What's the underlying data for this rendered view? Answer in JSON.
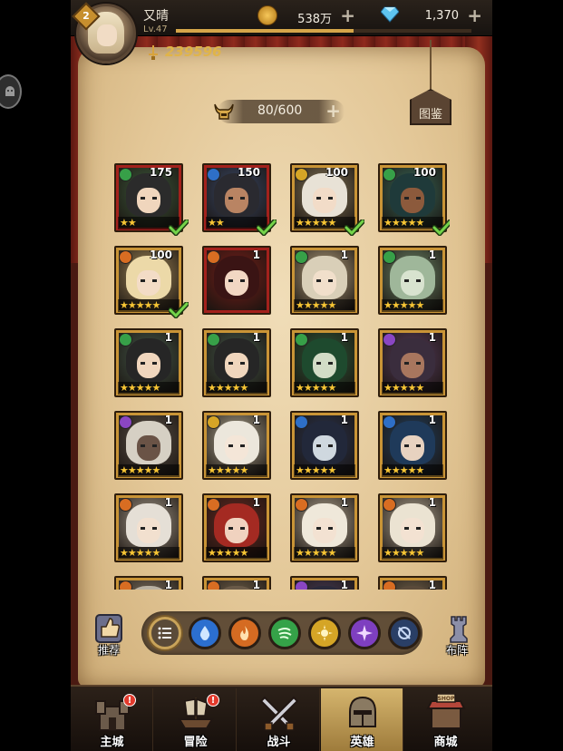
{
  "player": {
    "name": "又晴",
    "level_label": "Lv.47",
    "badge_level": "2",
    "power": "239596",
    "xp_fraction": 0.6
  },
  "resources": {
    "gold": "538万",
    "gems": "1,370"
  },
  "hero_count": "80/600",
  "collection_label": "图鉴",
  "heroes": [
    {
      "level": "175",
      "element": "wind",
      "stars": 2,
      "frame": "red",
      "check": true,
      "hair": "#2b2b2b",
      "skin": "#f0d6bd",
      "bg": "#3d5a3d"
    },
    {
      "level": "150",
      "element": "water",
      "stars": 2,
      "frame": "red",
      "check": true,
      "hair": "#2a2a30",
      "skin": "#b98463",
      "bg": "#3a4a6a"
    },
    {
      "level": "100",
      "element": "light",
      "stars": 5,
      "frame": "gold",
      "check": true,
      "hair": "#e8e2d6",
      "skin": "#f2dcc8",
      "bg": "#8a7a5a"
    },
    {
      "level": "100",
      "element": "wind",
      "stars": 5,
      "frame": "gold",
      "check": true,
      "hair": "#1f3a3a",
      "skin": "#8c5a3c",
      "bg": "#3a6a5a"
    },
    {
      "level": "100",
      "element": "fire",
      "stars": 5,
      "frame": "gold",
      "check": true,
      "hair": "#ecd9a8",
      "skin": "#f3dcc6",
      "bg": "#a48a5a"
    },
    {
      "level": "1",
      "element": "fire",
      "stars": 0,
      "frame": "red",
      "check": false,
      "hair": "#3a1414",
      "skin": "#f2d7c3",
      "bg": "#7a1f1a"
    },
    {
      "level": "1",
      "element": "wind",
      "stars": 5,
      "frame": "gold",
      "check": false,
      "hair": "#d9cfb8",
      "skin": "#f1dfcb",
      "bg": "#b8a480"
    },
    {
      "level": "1",
      "element": "wind",
      "stars": 5,
      "frame": "gold",
      "check": false,
      "hair": "#9fb79a",
      "skin": "#d8e3cf",
      "bg": "#6f8a6a"
    },
    {
      "level": "1",
      "element": "wind",
      "stars": 5,
      "frame": "gold",
      "check": false,
      "hair": "#262626",
      "skin": "#f0d6bd",
      "bg": "#44584a"
    },
    {
      "level": "1",
      "element": "wind",
      "stars": 5,
      "frame": "gold",
      "check": false,
      "hair": "#262626",
      "skin": "#f0d6bd",
      "bg": "#44584a"
    },
    {
      "level": "1",
      "element": "wind",
      "stars": 5,
      "frame": "gold",
      "check": false,
      "hair": "#1e4a2e",
      "skin": "#d2dcc6",
      "bg": "#2f5a3a"
    },
    {
      "level": "1",
      "element": "dark",
      "stars": 5,
      "frame": "gold",
      "check": false,
      "hair": "#3a2d3d",
      "skin": "#a8765e",
      "bg": "#5a3e5e"
    },
    {
      "level": "1",
      "element": "dark",
      "stars": 5,
      "frame": "gold",
      "check": false,
      "hair": "#d6d0c4",
      "skin": "#6a5346",
      "bg": "#5c5248"
    },
    {
      "level": "1",
      "element": "light",
      "stars": 5,
      "frame": "gold",
      "check": false,
      "hair": "#ece7dc",
      "skin": "#f4e6d8",
      "bg": "#b4ab94"
    },
    {
      "level": "1",
      "element": "water",
      "stars": 5,
      "frame": "gold",
      "check": false,
      "hair": "#22283a",
      "skin": "#cfd8df",
      "bg": "#2a3550"
    },
    {
      "level": "1",
      "element": "water",
      "stars": 5,
      "frame": "gold",
      "check": false,
      "hair": "#1f3a5a",
      "skin": "#e7d2c0",
      "bg": "#23405e"
    },
    {
      "level": "1",
      "element": "fire",
      "stars": 5,
      "frame": "gold",
      "check": false,
      "hair": "#e5dfd6",
      "skin": "#f2e0cf",
      "bg": "#a89c8c"
    },
    {
      "level": "1",
      "element": "fire",
      "stars": 5,
      "frame": "gold",
      "check": false,
      "hair": "#a42a22",
      "skin": "#f0d2bf",
      "bg": "#6a2a22"
    },
    {
      "level": "1",
      "element": "fire",
      "stars": 5,
      "frame": "gold",
      "check": false,
      "hair": "#efe8da",
      "skin": "#f3e2d2",
      "bg": "#b8ab96"
    },
    {
      "level": "1",
      "element": "fire",
      "stars": 5,
      "frame": "gold",
      "check": false,
      "hair": "#ebe3d2",
      "skin": "#f3e2d2",
      "bg": "#b8ab96"
    },
    {
      "level": "1",
      "element": "fire",
      "stars": 0,
      "frame": "gold",
      "check": false,
      "hair": "#b9b1a2",
      "skin": "#f0d9c6",
      "bg": "#8a7d6a"
    },
    {
      "level": "1",
      "element": "fire",
      "stars": 0,
      "frame": "gold",
      "check": false,
      "hair": "#6a5a48",
      "skin": "#f0d9c6",
      "bg": "#7a6a52"
    },
    {
      "level": "1",
      "element": "dark",
      "stars": 0,
      "frame": "gold",
      "check": false,
      "hair": "#2a2a3a",
      "skin": "#e0d0c0",
      "bg": "#4a3e5a"
    },
    {
      "level": "1",
      "element": "fire",
      "stars": 0,
      "frame": "gold",
      "check": false,
      "hair": "#5a4a3a",
      "skin": "#f0d9c6",
      "bg": "#7a6a52"
    }
  ],
  "side_buttons": {
    "recommend": "推荐",
    "formation": "布阵"
  },
  "filters": [
    "all",
    "water",
    "fire",
    "wind",
    "light",
    "dark",
    "void"
  ],
  "nav": [
    {
      "label": "主城",
      "badge": "!"
    },
    {
      "label": "冒险",
      "badge": "!"
    },
    {
      "label": "战斗",
      "badge": ""
    },
    {
      "label": "英雄",
      "badge": ""
    },
    {
      "label": "商城",
      "badge": ""
    }
  ],
  "shop_sign": "SHOP",
  "colors": {
    "wind": "#37a048",
    "water": "#2e6fc7",
    "fire": "#d86d22",
    "light": "#d5a526",
    "dark": "#8a46c2",
    "gold_frame": "#c99436",
    "red_frame": "#a3211c",
    "power_text": "#e0b448"
  }
}
